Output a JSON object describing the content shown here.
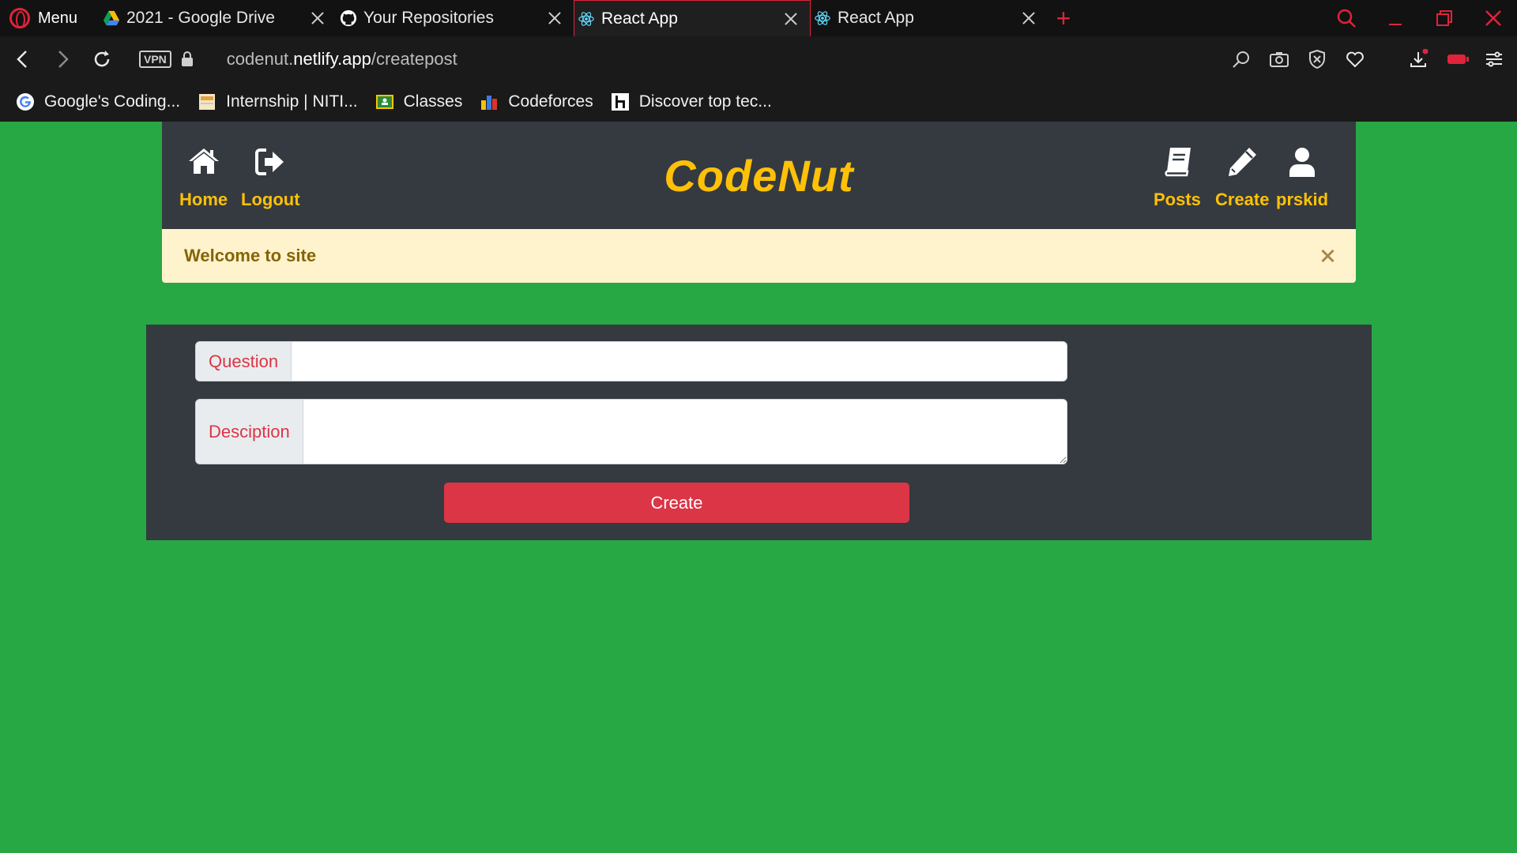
{
  "browser": {
    "menu_label": "Menu",
    "tabs": [
      {
        "title": "2021 - Google Drive",
        "icon": "google-drive-icon",
        "active": false
      },
      {
        "title": "Your Repositories",
        "icon": "github-icon",
        "active": false
      },
      {
        "title": "React App",
        "icon": "react-icon",
        "active": true
      },
      {
        "title": "React App",
        "icon": "react-icon",
        "active": false
      }
    ],
    "vpn_label": "VPN",
    "url_prefix": "codenut.",
    "url_domain": "netlify.app",
    "url_path": "/createpost",
    "bookmarks": [
      {
        "label": "Google's Coding...",
        "icon": "google-icon"
      },
      {
        "label": "Internship | NITI...",
        "icon": "page-icon"
      },
      {
        "label": "Classes",
        "icon": "classroom-icon"
      },
      {
        "label": "Codeforces",
        "icon": "codeforces-icon"
      },
      {
        "label": "Discover top tec...",
        "icon": "hackerrank-icon"
      }
    ],
    "accent_color": "#e0233a"
  },
  "site": {
    "brand": "CodeNut",
    "nav_left": [
      {
        "label": "Home",
        "icon": "home-icon"
      },
      {
        "label": "Logout",
        "icon": "logout-icon"
      }
    ],
    "nav_right": [
      {
        "label": "Posts",
        "icon": "book-icon"
      },
      {
        "label": "Create",
        "icon": "pencil-icon"
      },
      {
        "label": "prskid",
        "icon": "user-icon"
      }
    ],
    "alert": "Welcome to site",
    "form": {
      "question_label": "Question",
      "question_value": "",
      "description_label": "Desciption",
      "description_value": "",
      "submit_label": "Create"
    },
    "colors": {
      "page_bg": "#28a745",
      "navbar_bg": "#343a40",
      "brand": "#ffc107",
      "alert_bg": "#fff3cd",
      "danger": "#dc3545"
    }
  }
}
